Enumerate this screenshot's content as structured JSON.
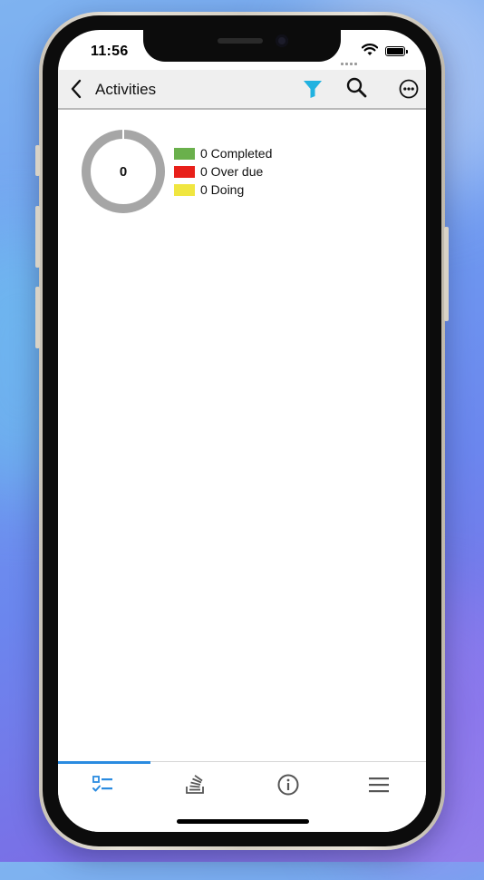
{
  "status_bar": {
    "time": "11:56"
  },
  "header": {
    "title": "Activities"
  },
  "summary": {
    "total": "0",
    "legend": [
      {
        "label": "0 Completed",
        "color": "#6ab04c"
      },
      {
        "label": "0 Over due",
        "color": "#e8201a"
      },
      {
        "label": "0 Doing",
        "color": "#f0e640"
      }
    ],
    "ring_color": "#a6a6a6"
  },
  "tabs": [
    {
      "icon": "task-list-icon",
      "active": true
    },
    {
      "icon": "stacked-inbox-icon",
      "active": false
    },
    {
      "icon": "info-icon",
      "active": false
    },
    {
      "icon": "menu-icon",
      "active": false
    }
  ],
  "colors": {
    "accent": "#2a8be0",
    "filter": "#21b2e0"
  }
}
